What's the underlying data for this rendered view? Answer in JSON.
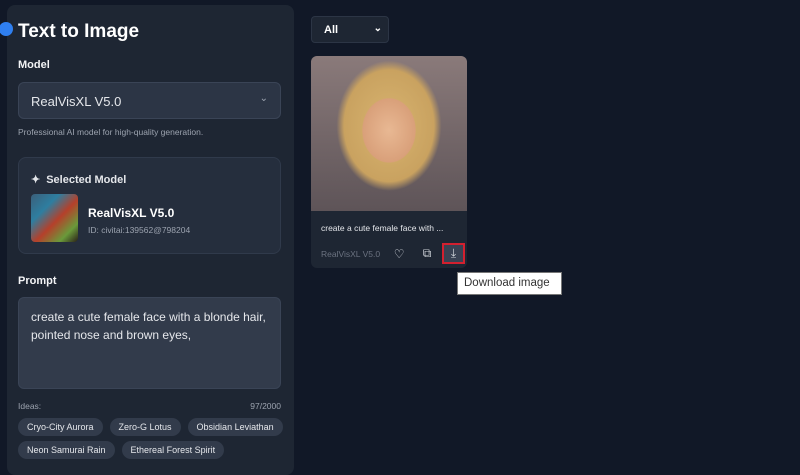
{
  "sidebar": {
    "title": "Text to Image",
    "model_label": "Model",
    "model_value": "RealVisXL V5.0",
    "model_help": "Professional AI model for high-quality generation.",
    "selected_header": "Selected Model",
    "selected_name": "RealVisXL V5.0",
    "selected_id": "ID: civitai:139562@798204",
    "prompt_label": "Prompt",
    "prompt_value": "create a cute female face with a blonde hair, pointed nose and brown eyes,",
    "ideas_label": "Ideas:",
    "char_count": "97/2000",
    "ideas": [
      "Cryo-City Aurora",
      "Zero-G Lotus",
      "Obsidian Leviathan",
      "Neon Samurai Rain",
      "Ethereal Forest Spirit"
    ]
  },
  "gallery": {
    "filter_value": "All",
    "card": {
      "caption": "create a cute female face with ...",
      "model": "RealVisXL V5.0"
    },
    "tooltip": "Download image"
  },
  "colors": {
    "background": "#111827",
    "panel": "#1e2633",
    "highlight": "#d3202f"
  }
}
